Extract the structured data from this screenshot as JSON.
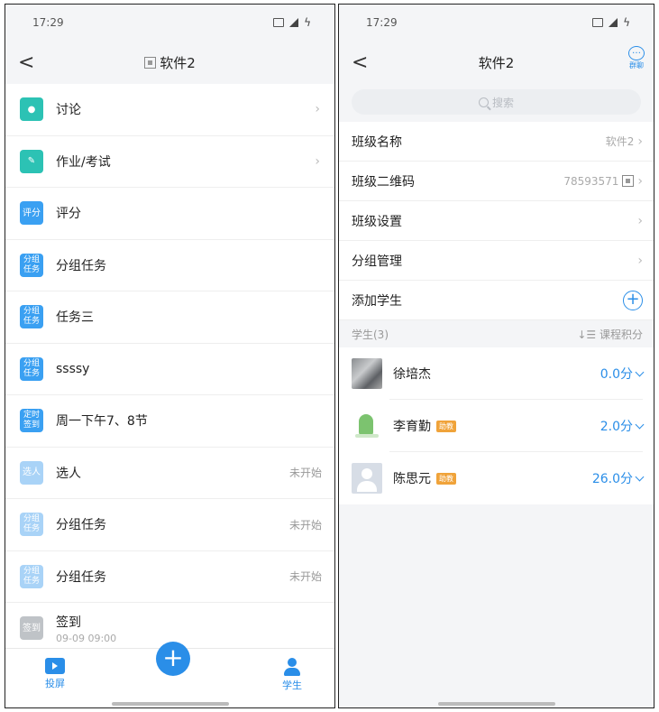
{
  "left": {
    "status": {
      "time": "17:29"
    },
    "nav": {
      "title": "软件2",
      "back": "<"
    },
    "activities": [
      {
        "icon": "讨论",
        "icon_text": "",
        "label": "讨论",
        "status": "",
        "arrow": true
      },
      {
        "icon": "作业",
        "icon_text": "",
        "label": "作业/考试",
        "status": "",
        "arrow": true
      },
      {
        "icon": "评分",
        "icon_text": "评分",
        "label": "评分",
        "status": "",
        "arrow": false
      },
      {
        "icon": "分组任务",
        "icon_text": "分组任务",
        "label": "分组任务",
        "status": "",
        "arrow": false
      },
      {
        "icon": "分组任务",
        "icon_text": "分组任务",
        "label": "任务三",
        "status": "",
        "arrow": false
      },
      {
        "icon": "分组任务",
        "icon_text": "分组任务",
        "label": "ssssy",
        "status": "",
        "arrow": false
      },
      {
        "icon": "定时签到",
        "icon_text": "定时签到",
        "label": "周一下午7、8节",
        "status": "",
        "arrow": false
      },
      {
        "icon": "选人",
        "icon_text": "选人",
        "label": "选人",
        "status": "未开始",
        "arrow": false
      },
      {
        "icon": "分组任务",
        "icon_text": "分组任务",
        "label": "分组任务",
        "status": "未开始",
        "arrow": false
      },
      {
        "icon": "分组任务",
        "icon_text": "分组任务",
        "label": "分组任务",
        "status": "未开始",
        "arrow": false
      },
      {
        "icon": "签到",
        "icon_text": "签到",
        "label": "签到",
        "sub": "09-09 09:00",
        "status": "",
        "arrow": false
      }
    ],
    "tabbar": {
      "screen": "投屏",
      "add": "+",
      "students": "学生"
    }
  },
  "right": {
    "status": {
      "time": "17:29"
    },
    "nav": {
      "title": "软件2",
      "back": "<",
      "chat_label": "群聊"
    },
    "search_placeholder": "搜索",
    "settings": [
      {
        "label": "班级名称",
        "value": "软件2"
      },
      {
        "label": "班级二维码",
        "value": "78593571"
      },
      {
        "label": "班级设置",
        "value": ""
      },
      {
        "label": "分组管理",
        "value": ""
      },
      {
        "label": "添加学生",
        "value": ""
      }
    ],
    "students_header": {
      "count": "学生(3)",
      "sort": "↓☰ 课程积分"
    },
    "students": [
      {
        "name": "徐培杰",
        "badge": "",
        "score": "0.0分"
      },
      {
        "name": "李育勤",
        "badge": "助教",
        "score": "2.0分"
      },
      {
        "name": "陈思元",
        "badge": "助教",
        "score": "26.0分"
      }
    ]
  },
  "colors": {
    "accent": "#2a8ee8",
    "teal": "#2cc2b4",
    "badge": "#f0a33a"
  }
}
